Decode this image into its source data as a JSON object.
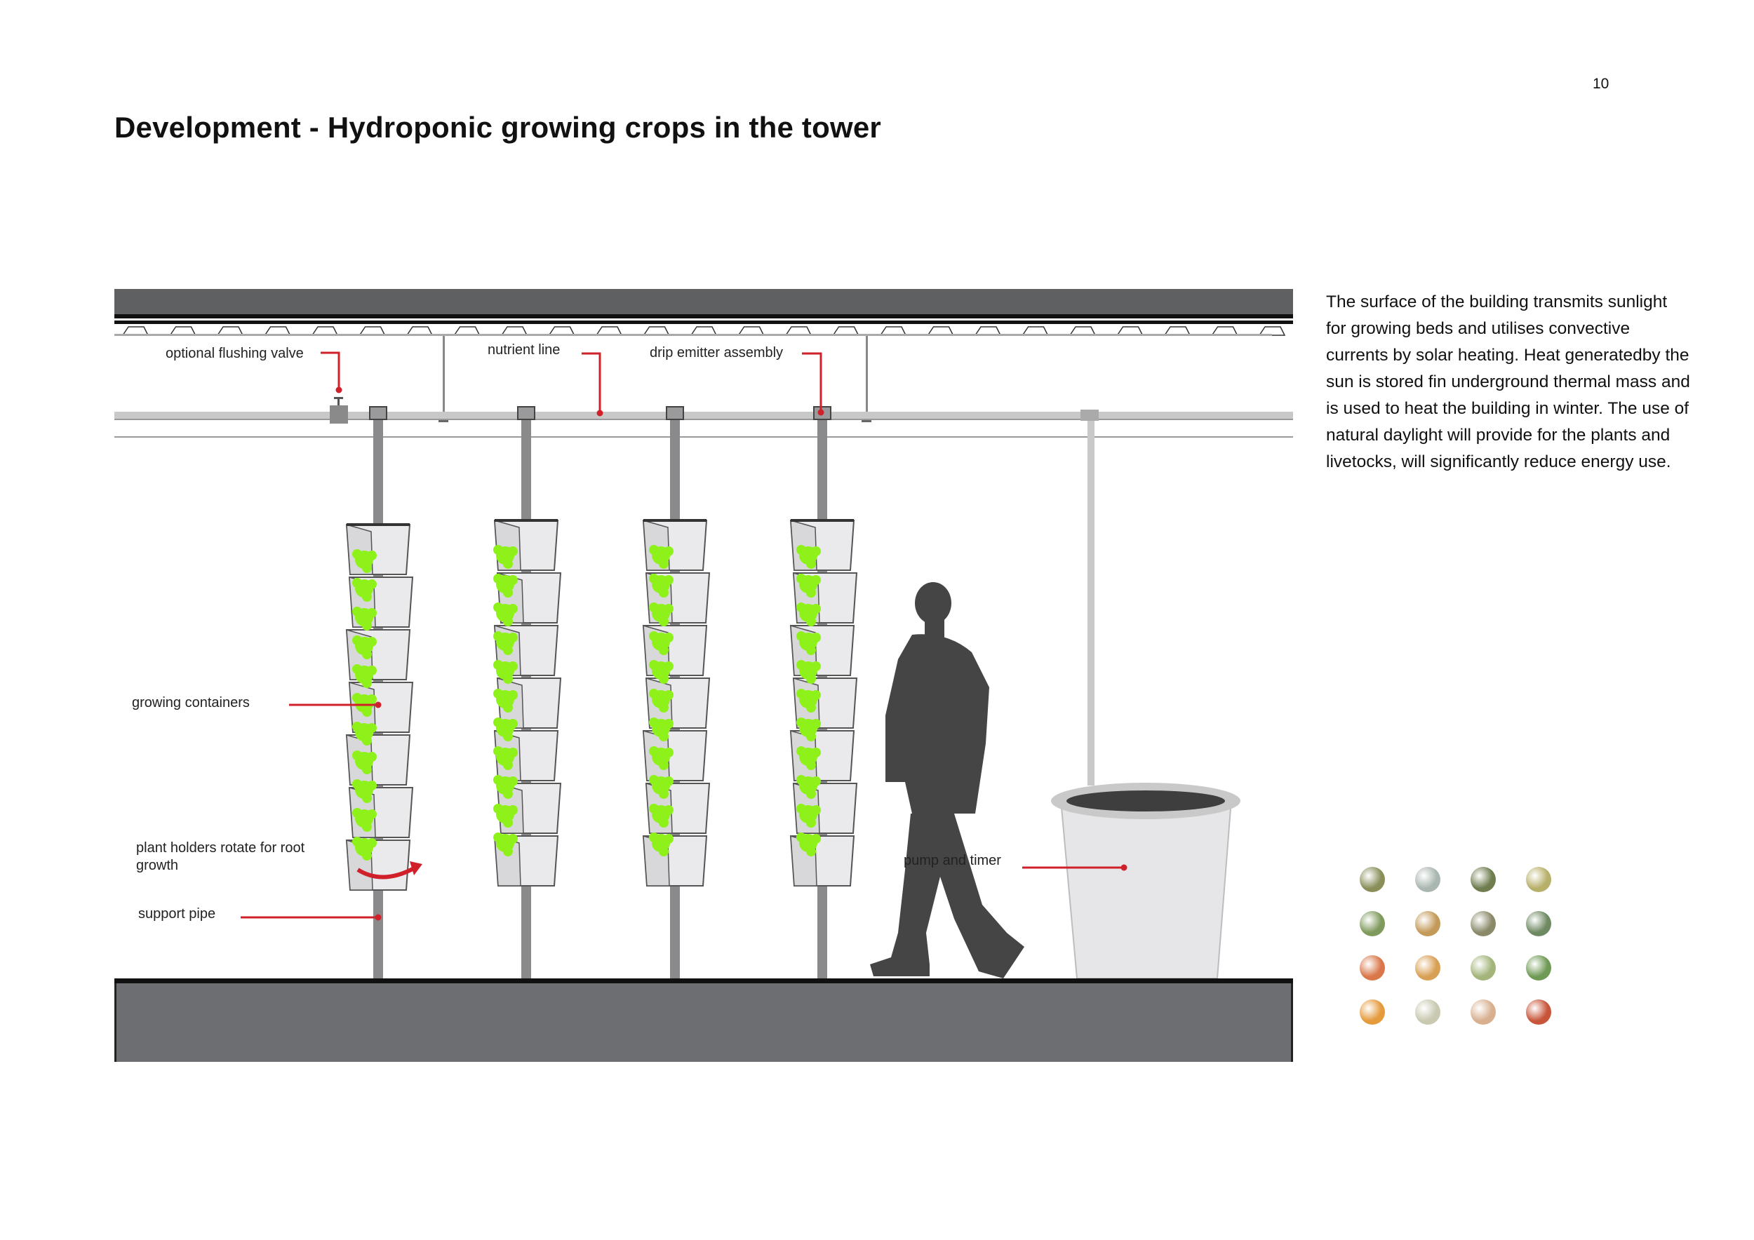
{
  "page": {
    "number": "10",
    "title": "Development - Hydroponic growing crops in the tower"
  },
  "description": "The surface of the building transmits sunlight for growing beds and utilises convective currents by solar heating. Heat generatedby the sun is stored fin underground thermal mass and is used to heat the building in winter. The use of natural daylight will provide for the plants and livetocks, will significantly reduce energy use.",
  "labels": {
    "flushing_valve": "optional flushing valve",
    "nutrient_line": "nutrient line",
    "drip_emitter": "drip emitter assembly",
    "growing_containers": "growing containers",
    "plant_holders_1": "plant holders rotate for root",
    "plant_holders_2": "growth",
    "support_pipe": "support pipe",
    "pump_timer": "pump and timer"
  },
  "colors": {
    "callout": "#d0202a",
    "plant": "#8ef21a",
    "floor": "#6d6e71",
    "figure": "#454545"
  },
  "produce": [
    "#8a8f5a",
    "#a9b7b0",
    "#6f7d4f",
    "#b7b06a",
    "#7f9a5d",
    "#c49a5a",
    "#8a8a6a",
    "#6f8a62",
    "#d9774a",
    "#d8a055",
    "#a3b57a",
    "#6f9a55",
    "#e59a3c",
    "#c9c8b0",
    "#d8b090",
    "#c8553a"
  ]
}
